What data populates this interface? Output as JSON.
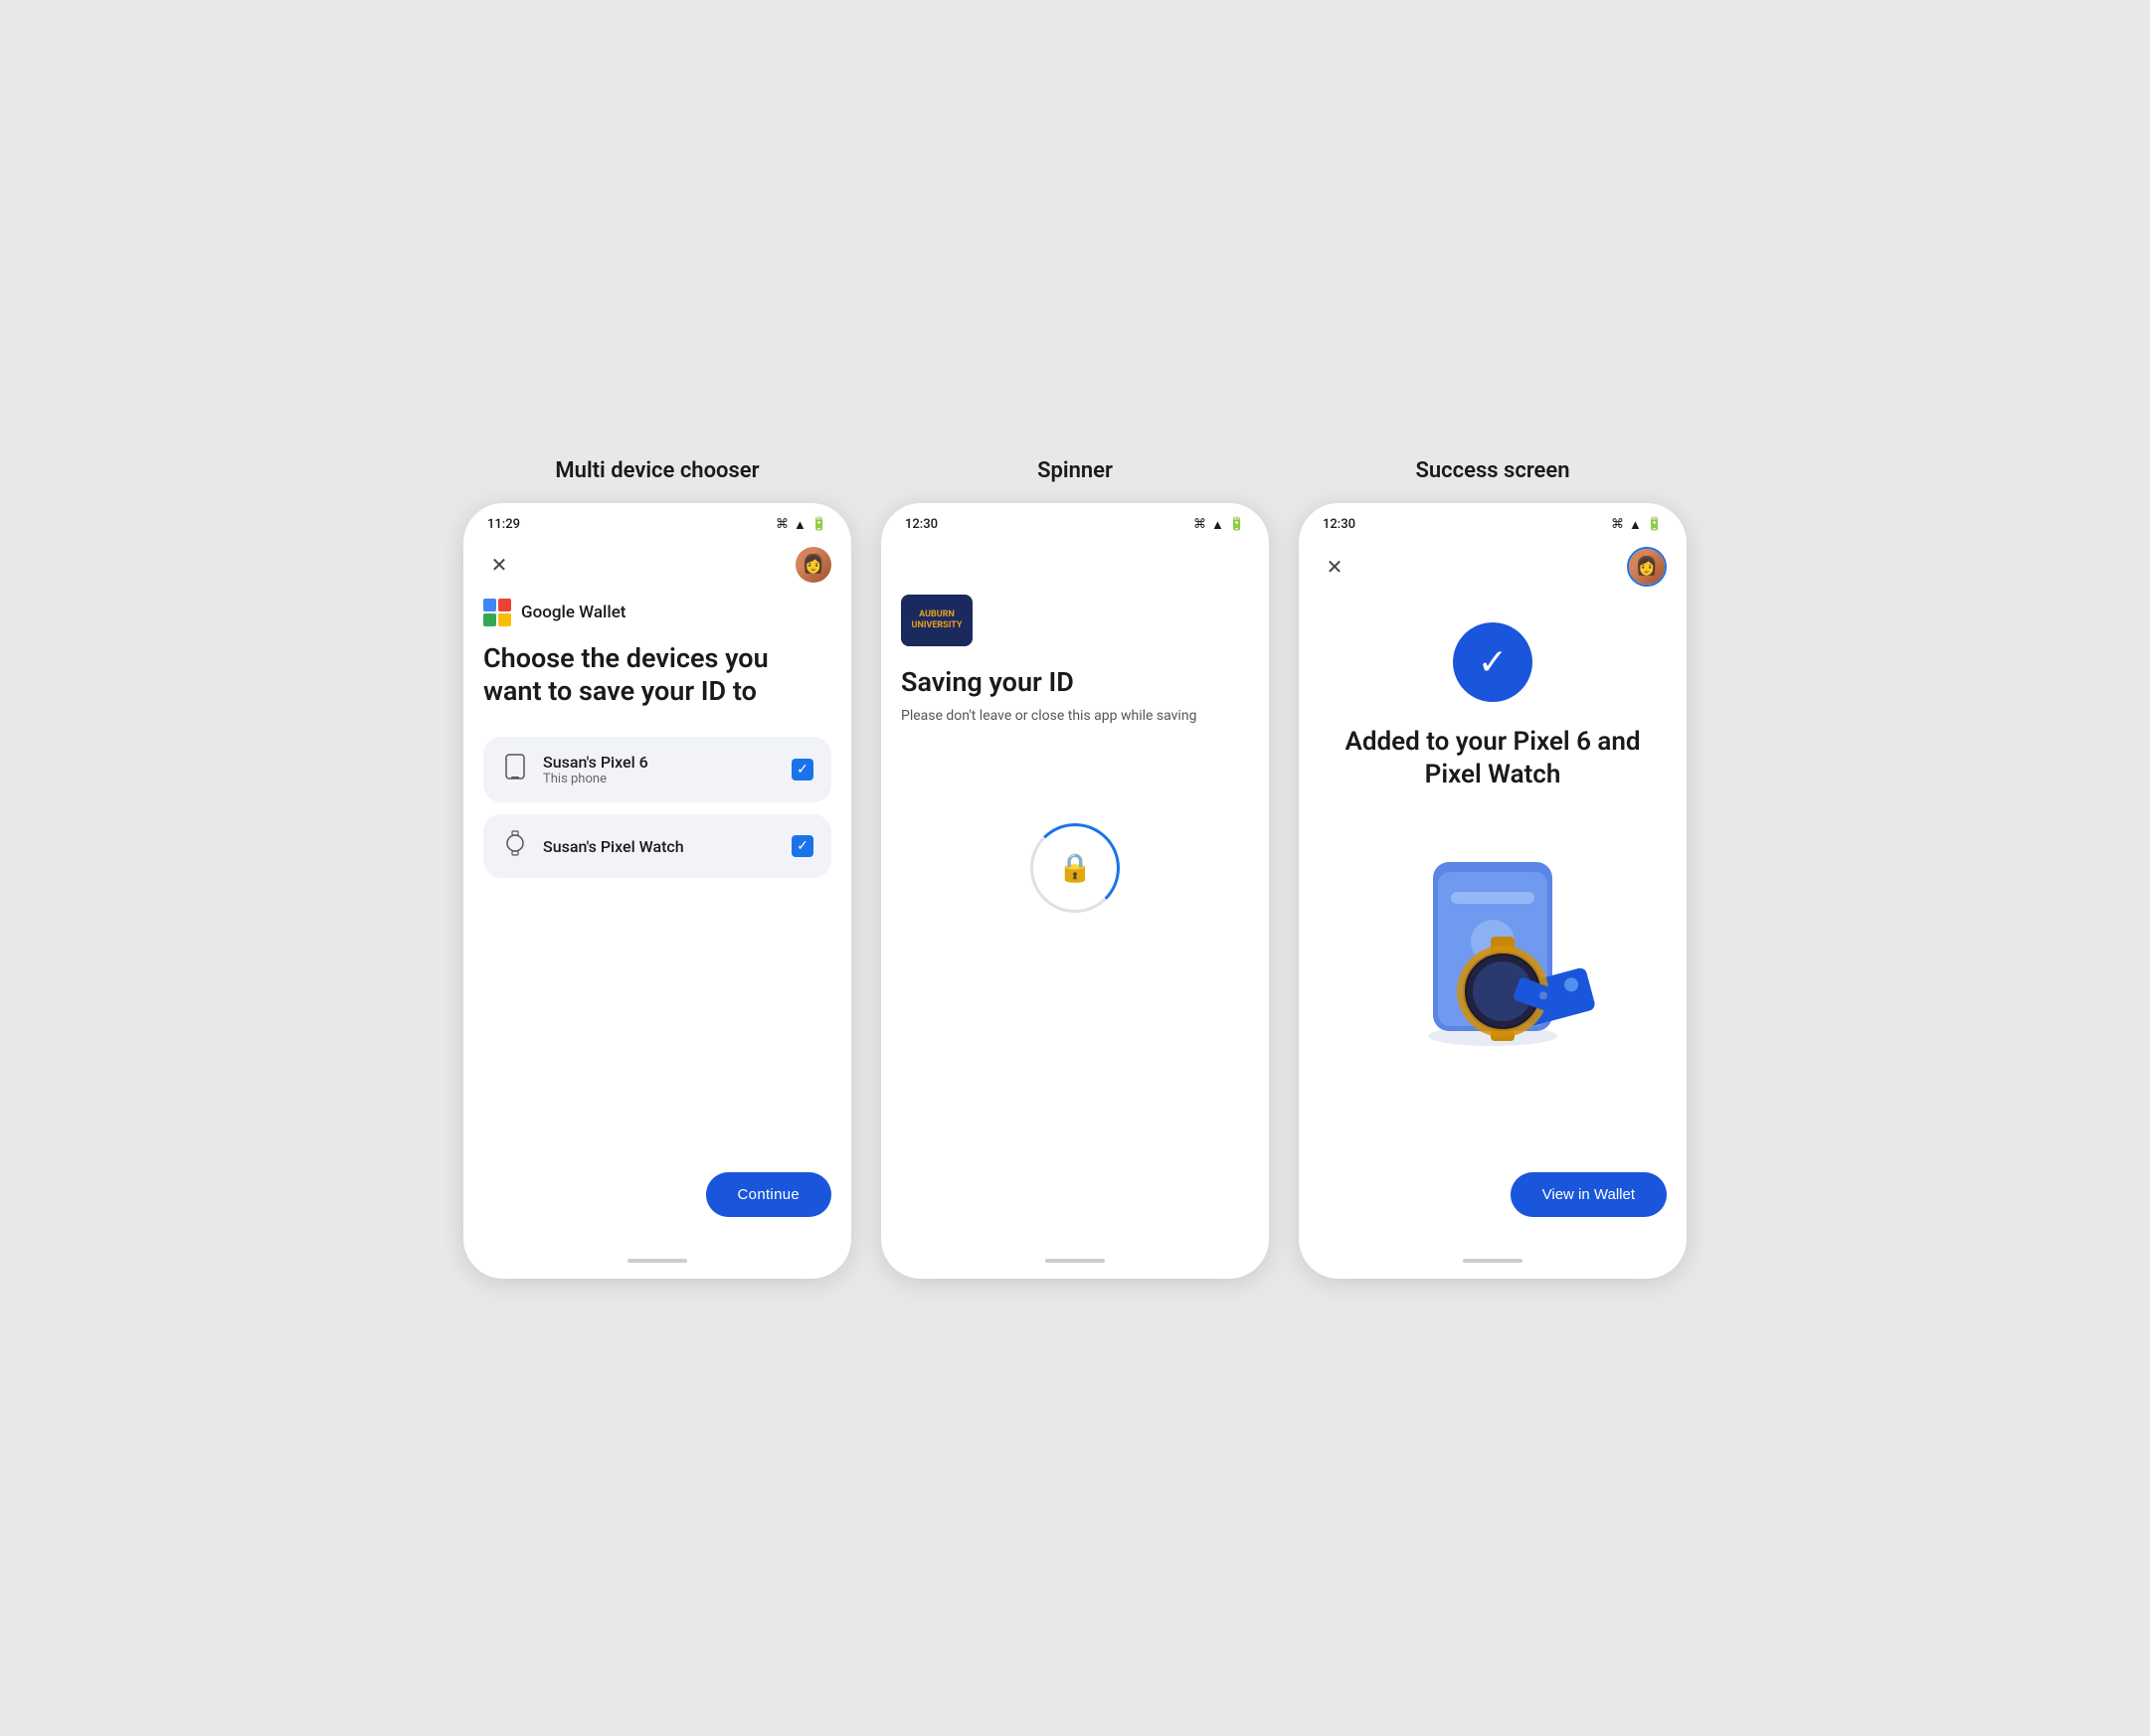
{
  "page": {
    "background": "#e8e8e8"
  },
  "screen1": {
    "title": "Multi device chooser",
    "status_time": "11:29",
    "wallet_name": "Google Wallet",
    "heading": "Choose the devices you want to save your ID to",
    "device1_name": "Susan's Pixel 6",
    "device1_sub": "This phone",
    "device2_name": "Susan's Pixel Watch",
    "continue_label": "Continue"
  },
  "screen2": {
    "title": "Spinner",
    "status_time": "12:30",
    "institution_line1": "AUBURN",
    "institution_line2": "UNIVERSITY",
    "saving_title": "Saving your ID",
    "saving_sub": "Please don't leave or close this app while saving"
  },
  "screen3": {
    "title": "Success screen",
    "status_time": "12:30",
    "success_title": "Added to your Pixel 6 and Pixel Watch",
    "view_wallet_label": "View in Wallet"
  }
}
